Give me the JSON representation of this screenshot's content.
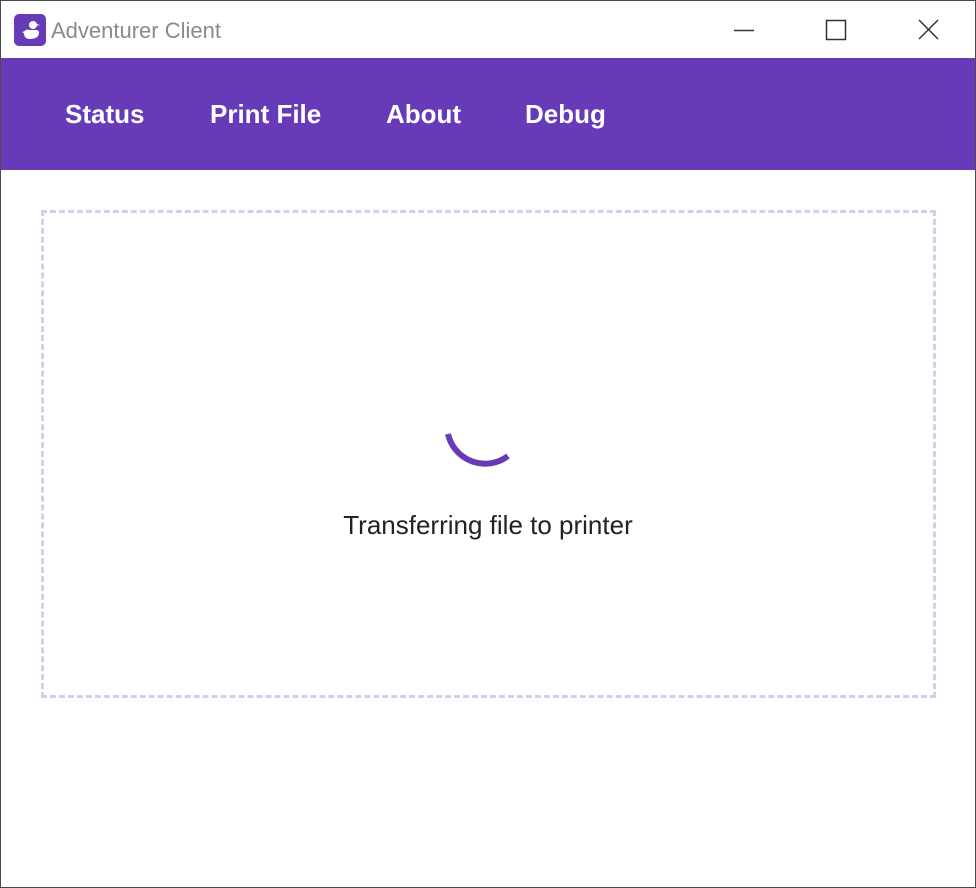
{
  "window": {
    "title": "Adventurer Client",
    "icon": "duck-icon",
    "controls": [
      "minimize-icon",
      "maximize-icon",
      "close-icon"
    ]
  },
  "nav": {
    "items": [
      {
        "label": "Status"
      },
      {
        "label": "Print File"
      },
      {
        "label": "About"
      },
      {
        "label": "Debug"
      }
    ]
  },
  "main": {
    "status_text": "Transferring file to printer",
    "spinner_icon": "loading-spinner-icon"
  },
  "colors": {
    "accent": "#673ab7",
    "dropzone_border": "#d3cfe6",
    "title_text": "#8a8a8a",
    "body_text": "#222222"
  }
}
